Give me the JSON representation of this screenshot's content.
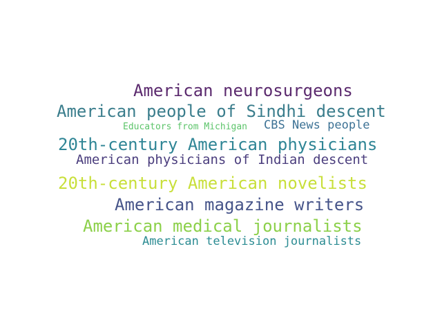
{
  "words": [
    {
      "text": "American neurosurgeons",
      "color": "#5b2a6e"
    },
    {
      "text": "American people of Sindhi descent",
      "color": "#3a7d8c"
    },
    {
      "text": "Educators from Michigan",
      "color": "#5cc46a"
    },
    {
      "text": "CBS News people",
      "color": "#3d7295"
    },
    {
      "text": "20th-century American physicians",
      "color": "#2f8595"
    },
    {
      "text": "American physicians of Indian descent",
      "color": "#4a3d7d"
    },
    {
      "text": "20th-century American novelists",
      "color": "#c8df3a"
    },
    {
      "text": "American magazine writers",
      "color": "#465489"
    },
    {
      "text": "American medical journalists",
      "color": "#8cd04a"
    },
    {
      "text": "American television journalists",
      "color": "#2c8c93"
    }
  ]
}
